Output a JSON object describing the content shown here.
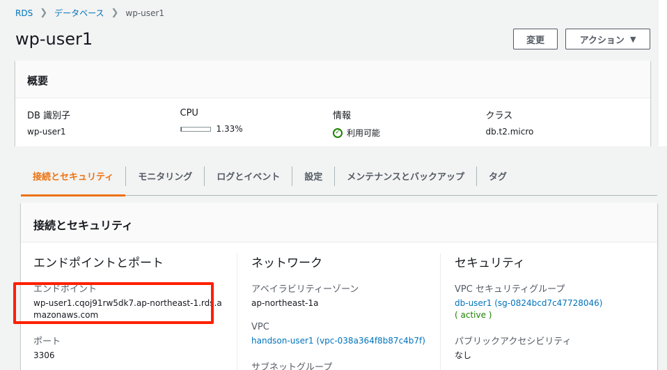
{
  "breadcrumb": {
    "rds": "RDS",
    "databases": "データベース",
    "current": "wp-user1"
  },
  "page_title": "wp-user1",
  "buttons": {
    "change": "変更",
    "actions": "アクション"
  },
  "summary": {
    "header": "概要",
    "db_id_label": "DB 識別子",
    "db_id_value": "wp-user1",
    "cpu_label": "CPU",
    "cpu_value": "1.33%",
    "cpu_fraction": 0.0133,
    "info_label": "情報",
    "info_value": "利用可能",
    "class_label": "クラス",
    "class_value": "db.t2.micro"
  },
  "tabs": [
    {
      "label": "接続とセキュリティ",
      "active": true
    },
    {
      "label": "モニタリング",
      "active": false
    },
    {
      "label": "ログとイベント",
      "active": false
    },
    {
      "label": "設定",
      "active": false
    },
    {
      "label": "メンテナンスとバックアップ",
      "active": false
    },
    {
      "label": "タグ",
      "active": false
    }
  ],
  "connectivity": {
    "header": "接続とセキュリティ",
    "endpoint_port": {
      "title": "エンドポイントとポート",
      "endpoint_label": "エンドポイント",
      "endpoint_value": "wp-user1.cqoj91rw5dk7.ap-northeast-1.rds.amazonaws.com",
      "port_label": "ポート",
      "port_value": "3306"
    },
    "network": {
      "title": "ネットワーク",
      "az_label": "アベイラビリティーゾーン",
      "az_value": "ap-northeast-1a",
      "vpc_label": "VPC",
      "vpc_value": "handson-user1 (vpc-038a364f8b87c4b7f)",
      "subnet_label": "サブネットグループ"
    },
    "security": {
      "title": "セキュリティ",
      "sg_label": "VPC セキュリティグループ",
      "sg_value": "db-user1 (sg-0824bcd7c47728046)",
      "sg_status": "( active )",
      "public_label": "パブリックアクセシビリティ",
      "public_value": "なし"
    }
  },
  "colors": {
    "link": "#0073bb",
    "active_tab": "#ec7211",
    "success": "#1d8102",
    "highlight": "#ff1f00"
  }
}
